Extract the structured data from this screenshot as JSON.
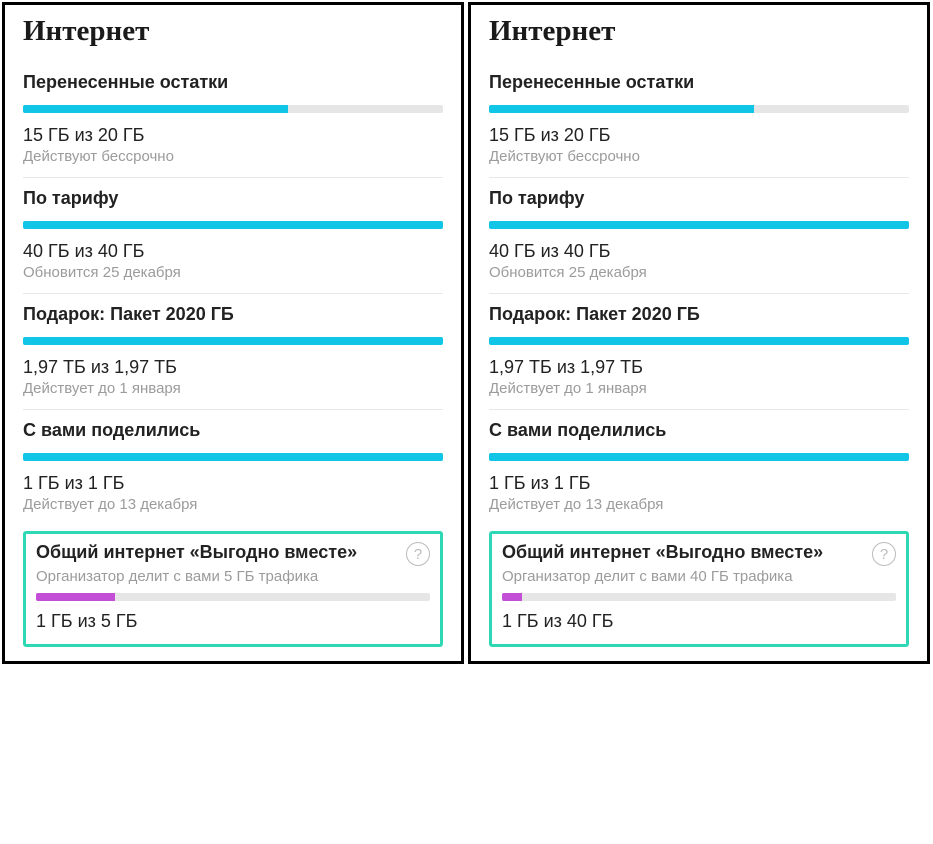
{
  "panels": [
    {
      "title": "Интернет",
      "sections": [
        {
          "title": "Перенесенные остатки",
          "percent": 63,
          "usage": "15 ГБ из 20 ГБ",
          "sub": "Действуют бессрочно",
          "color": "cyan"
        },
        {
          "title": "По тарифу",
          "percent": 100,
          "usage": "40 ГБ из 40 ГБ",
          "sub": "Обновится 25 декабря",
          "color": "cyan"
        },
        {
          "title": "Подарок: Пакет 2020 ГБ",
          "percent": 100,
          "usage": "1,97 ТБ из 1,97 ТБ",
          "sub": "Действует до 1 января",
          "color": "cyan"
        },
        {
          "title": "С вами поделились",
          "percent": 100,
          "usage": "1 ГБ из 1 ГБ",
          "sub": "Действует до 13 декабря",
          "color": "cyan"
        }
      ],
      "highlight": {
        "title": "Общий интернет «Выгодно вместе»",
        "sub": "Организатор делит с вами 5 ГБ трафика",
        "percent": 20,
        "usage": "1 ГБ из 5 ГБ"
      }
    },
    {
      "title": "Интернет",
      "sections": [
        {
          "title": "Перенесенные остатки",
          "percent": 63,
          "usage": "15 ГБ из 20 ГБ",
          "sub": "Действуют бессрочно",
          "color": "cyan"
        },
        {
          "title": "По тарифу",
          "percent": 100,
          "usage": "40 ГБ из 40 ГБ",
          "sub": "Обновится 25 декабря",
          "color": "cyan"
        },
        {
          "title": "Подарок: Пакет 2020 ГБ",
          "percent": 100,
          "usage": "1,97 ТБ из 1,97 ТБ",
          "sub": "Действует до 1 января",
          "color": "cyan"
        },
        {
          "title": "С вами поделились",
          "percent": 100,
          "usage": "1 ГБ из 1 ГБ",
          "sub": "Действует до 13 декабря",
          "color": "cyan"
        }
      ],
      "highlight": {
        "title": "Общий интернет «Выгодно вместе»",
        "sub": "Организатор делит с вами 40 ГБ трафика",
        "percent": 5,
        "usage": "1 ГБ из 40 ГБ"
      }
    }
  ],
  "help_glyph": "?"
}
